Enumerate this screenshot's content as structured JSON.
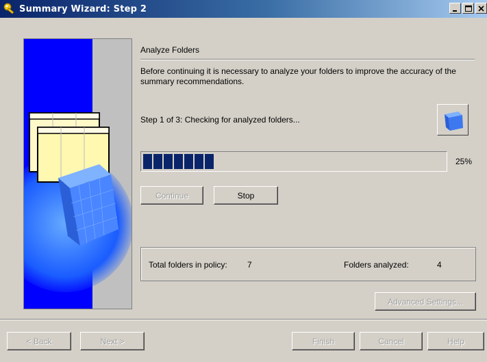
{
  "window": {
    "title": "Summary Wizard: Step 2"
  },
  "content": {
    "heading": "Analyze Folders",
    "description": "Before continuing it is necessary to analyze your folders to improve the accuracy of the summary recommendations.",
    "step_text": "Step 1 of 3: Checking for analyzed folders...",
    "progress": {
      "percent_label": "25%",
      "value": 25,
      "blocks": 7
    },
    "buttons": {
      "continue": "Continue",
      "stop": "Stop",
      "advanced": "Advanced Settings..."
    },
    "stats": {
      "total_label": "Total folders in policy:",
      "total_value": "7",
      "analyzed_label": "Folders analyzed:",
      "analyzed_value": "4"
    }
  },
  "footer": {
    "back": "< Back",
    "next": "Next >",
    "finish": "Finish",
    "cancel": "Cancel",
    "help": "Help"
  },
  "colors": {
    "accent_blue": "#0000ff",
    "progress_fill": "#0a246a",
    "dialog_bg": "#d4d0c8"
  },
  "icons": [
    "wizard-key-icon",
    "minimize-icon",
    "maximize-icon",
    "close-icon",
    "cube-icon"
  ]
}
